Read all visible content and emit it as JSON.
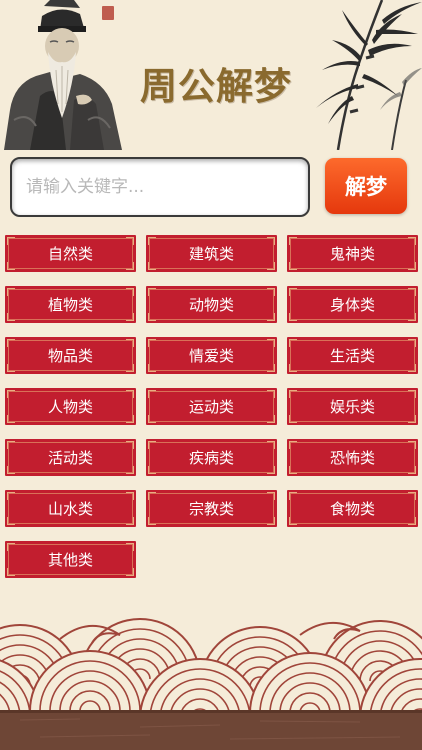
{
  "header": {
    "title": "周公解梦",
    "sage_icon": "sage-portrait-icon",
    "bamboo_icon": "bamboo-ink-icon"
  },
  "search": {
    "placeholder": "请输入关键字...",
    "value": "",
    "button_label": "解梦"
  },
  "categories": [
    {
      "label": "自然类"
    },
    {
      "label": "建筑类"
    },
    {
      "label": "鬼神类"
    },
    {
      "label": "植物类"
    },
    {
      "label": "动物类"
    },
    {
      "label": "身体类"
    },
    {
      "label": "物品类"
    },
    {
      "label": "情爱类"
    },
    {
      "label": "生活类"
    },
    {
      "label": "人物类"
    },
    {
      "label": "运动类"
    },
    {
      "label": "娱乐类"
    },
    {
      "label": "活动类"
    },
    {
      "label": "疾病类"
    },
    {
      "label": "恐怖类"
    },
    {
      "label": "山水类"
    },
    {
      "label": "宗教类"
    },
    {
      "label": "食物类"
    },
    {
      "label": "其他类"
    }
  ],
  "colors": {
    "background": "#f5ecd9",
    "category_red": "#c21e2f",
    "button_orange": "#f5521c",
    "title_brown": "#8a6a2e",
    "wave_line": "#a0453a",
    "ground_brown": "#6e4636"
  }
}
